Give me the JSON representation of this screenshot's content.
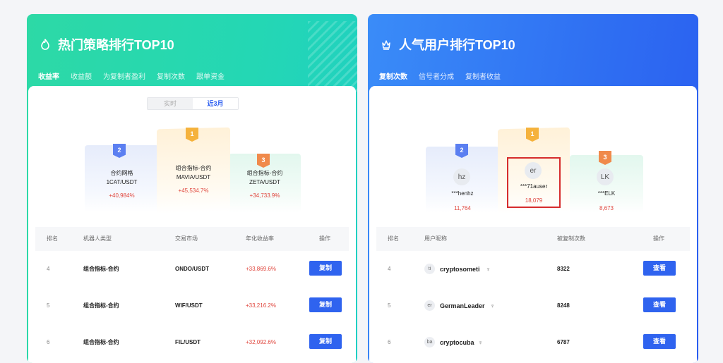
{
  "strategy": {
    "title": "热门策略排行TOP10",
    "tabs": [
      "收益率",
      "收益额",
      "为复制者盈利",
      "复制次数",
      "跟单资金"
    ],
    "toggle": [
      "实时",
      "近3月"
    ],
    "podium": [
      {
        "rank": "1",
        "name": "组合指标-合约",
        "pair": "MAVIA/USDT",
        "pct": "+45,534.7%"
      },
      {
        "rank": "2",
        "name": "合约网格",
        "pair": "1CAT/USDT",
        "pct": "+40,984%"
      },
      {
        "rank": "3",
        "name": "组合指标-合约",
        "pair": "ZETA/USDT",
        "pct": "+34,733.9%"
      }
    ],
    "columns": [
      "排名",
      "机器人类型",
      "交易市场",
      "年化收益率",
      "操作"
    ],
    "rows": [
      {
        "rank": "4",
        "type": "组合指标-合约",
        "market": "ONDO/USDT",
        "rate": "+33,869.6%",
        "action": "复制"
      },
      {
        "rank": "5",
        "type": "组合指标-合约",
        "market": "WIF/USDT",
        "rate": "+33,216.2%",
        "action": "复制"
      },
      {
        "rank": "6",
        "type": "组合指标-合约",
        "market": "FIL/USDT",
        "rate": "+32,092.6%",
        "action": "复制"
      }
    ]
  },
  "users": {
    "title": "人气用户排行TOP10",
    "tabs": [
      "复制次数",
      "信号者分成",
      "复制者收益"
    ],
    "podium": [
      {
        "rank": "1",
        "avatar": "er",
        "name": "***71auser",
        "count": "18,079"
      },
      {
        "rank": "2",
        "avatar": "hz",
        "name": "***henhz",
        "count": "11,764"
      },
      {
        "rank": "3",
        "avatar": "LK",
        "name": "***ELK",
        "count": "8,673"
      }
    ],
    "columns": [
      "排名",
      "用户昵称",
      "被复制次数",
      "操作"
    ],
    "rows": [
      {
        "rank": "4",
        "avatar": "ti",
        "name": "cryptosometi",
        "count": "8322",
        "action": "查看"
      },
      {
        "rank": "5",
        "avatar": "er",
        "name": "GermanLeader",
        "count": "8248",
        "action": "查看"
      },
      {
        "rank": "6",
        "avatar": "ba",
        "name": "cryptocuba",
        "count": "6787",
        "action": "查看"
      }
    ]
  },
  "icons": {
    "left_title": "flame-icon",
    "right_title": "crown-icon",
    "vip": "vip-icon"
  },
  "colors": {
    "green": "#2dd9a6",
    "blue": "#2f6ff2",
    "button": "#2f63ef",
    "gain": "#e0463d",
    "highlight": "#d62c2c"
  }
}
